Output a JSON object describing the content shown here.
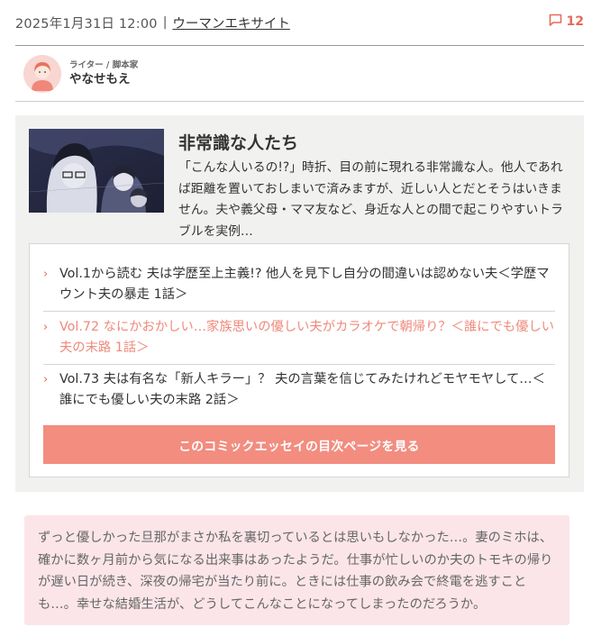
{
  "meta": {
    "date": "2025年1月31日 12:00",
    "separator": "|",
    "source": "ウーマンエキサイト",
    "comment_count": "12"
  },
  "author": {
    "role": "ライター / 脚本家",
    "name": "やなせもえ"
  },
  "series": {
    "title": "非常識な人たち",
    "description": "「こんな人いるの!?」時折、目の前に現れる非常識な人。他人であれば距離を置いておしまいで済みますが、近しい人とだとそうはいきません。夫や義父母・ママ友など、身近な人との間で起こりやすいトラブルを実例…",
    "episodes": [
      {
        "label": "Vol.1から読む 夫は学歴至上主義!? 他人を見下し自分の間違いは認めない夫＜学歴マウント夫の暴走 1話＞",
        "active": false
      },
      {
        "label": "Vol.72 なにかおかしい…家族思いの優しい夫がカラオケで朝帰り？＜誰にでも優しい夫の末路 1話＞",
        "active": true
      },
      {
        "label": "Vol.73 夫は有名な「新人キラー」？ 夫の言葉を信じてみたけれどモヤモヤして…＜誰にでも優しい夫の末路 2話＞",
        "active": false
      }
    ],
    "toc_button": "このコミックエッセイの目次ページを見る"
  },
  "lead": "ずっと優しかった旦那がまさか私を裏切っているとは思いもしなかった…。妻のミホは、確かに数ヶ月前から気になる出来事はあったようだ。仕事が忙しいのか夫のトモキの帰りが遅い日が続き、深夜の帰宅が当たり前に。ときには仕事の飲み会で終電を逃すことも…。幸せな結婚生活が、どうしてこんなことになってしまったのだろうか。",
  "icons": {
    "comments": "speech-bubble-icon",
    "episode_marker": "chevron-right-icon"
  },
  "colors": {
    "accent": "#e56b5c",
    "active_episode": "#ef8a7b",
    "button": "#f28d80",
    "series_bg": "#f1f1ef",
    "lead_bg": "#fbe5e9"
  }
}
